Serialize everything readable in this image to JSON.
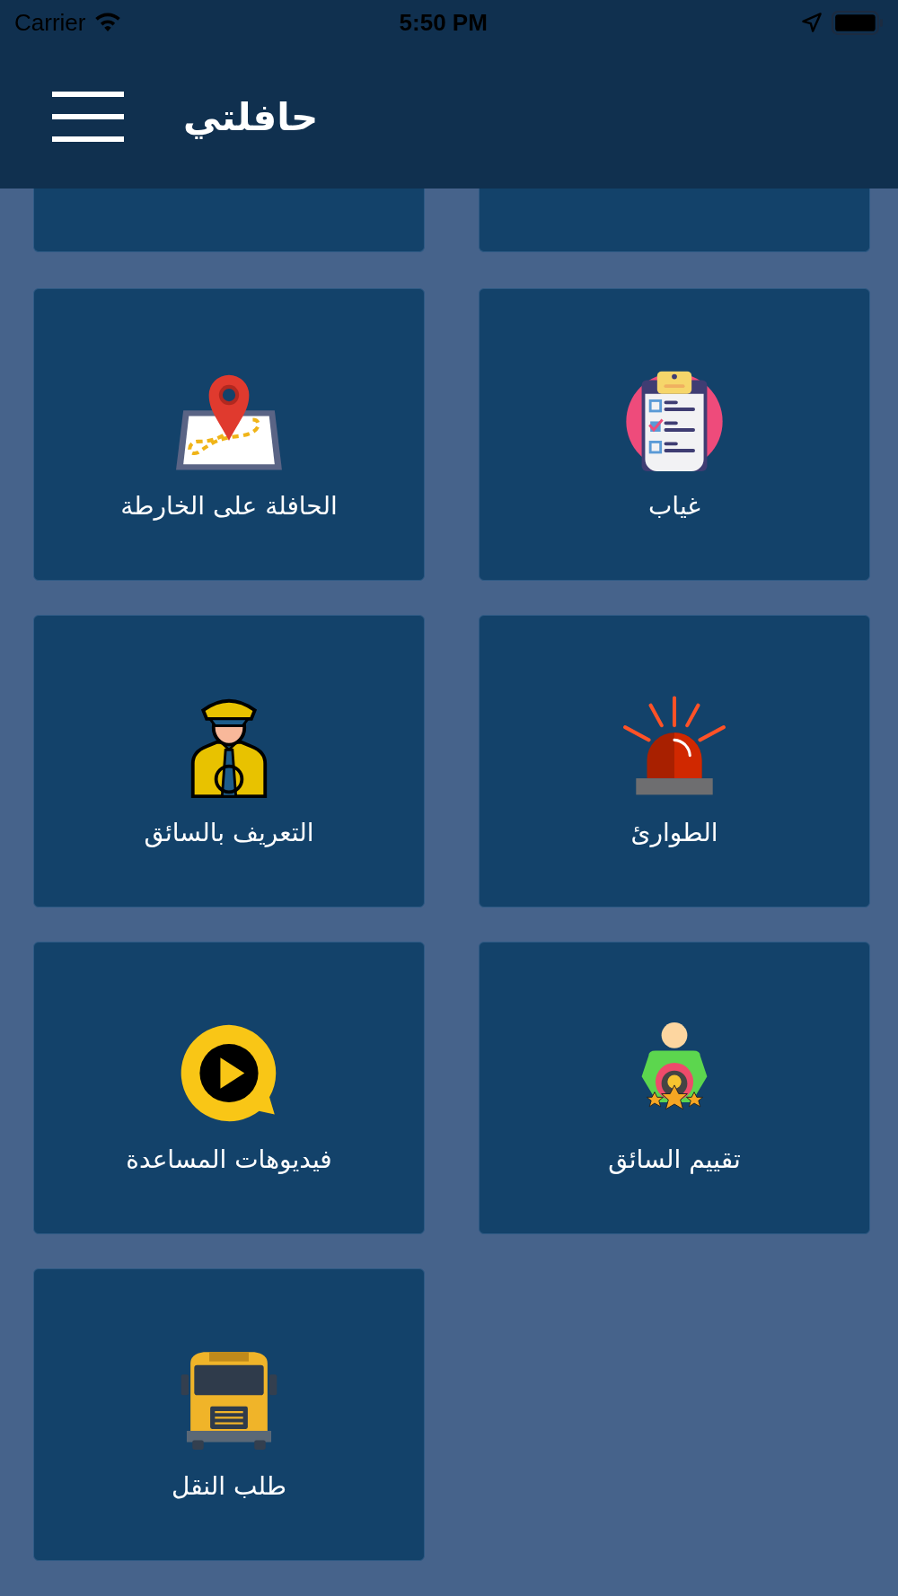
{
  "status_bar": {
    "carrier": "Carrier",
    "time": "5:50 PM"
  },
  "header": {
    "title": "حافلتي"
  },
  "tiles": [
    {
      "kind": "checklist",
      "label": "غياب"
    },
    {
      "kind": "map",
      "label": "الحافلة على الخارطة"
    },
    {
      "kind": "siren",
      "label": "الطوارئ"
    },
    {
      "kind": "driver",
      "label": "التعريف بالسائق"
    },
    {
      "kind": "rating",
      "label": "تقييم السائق"
    },
    {
      "kind": "video",
      "label": "فيديوهات المساعدة"
    },
    {
      "kind": "bus",
      "label": "طلب النقل"
    }
  ]
}
